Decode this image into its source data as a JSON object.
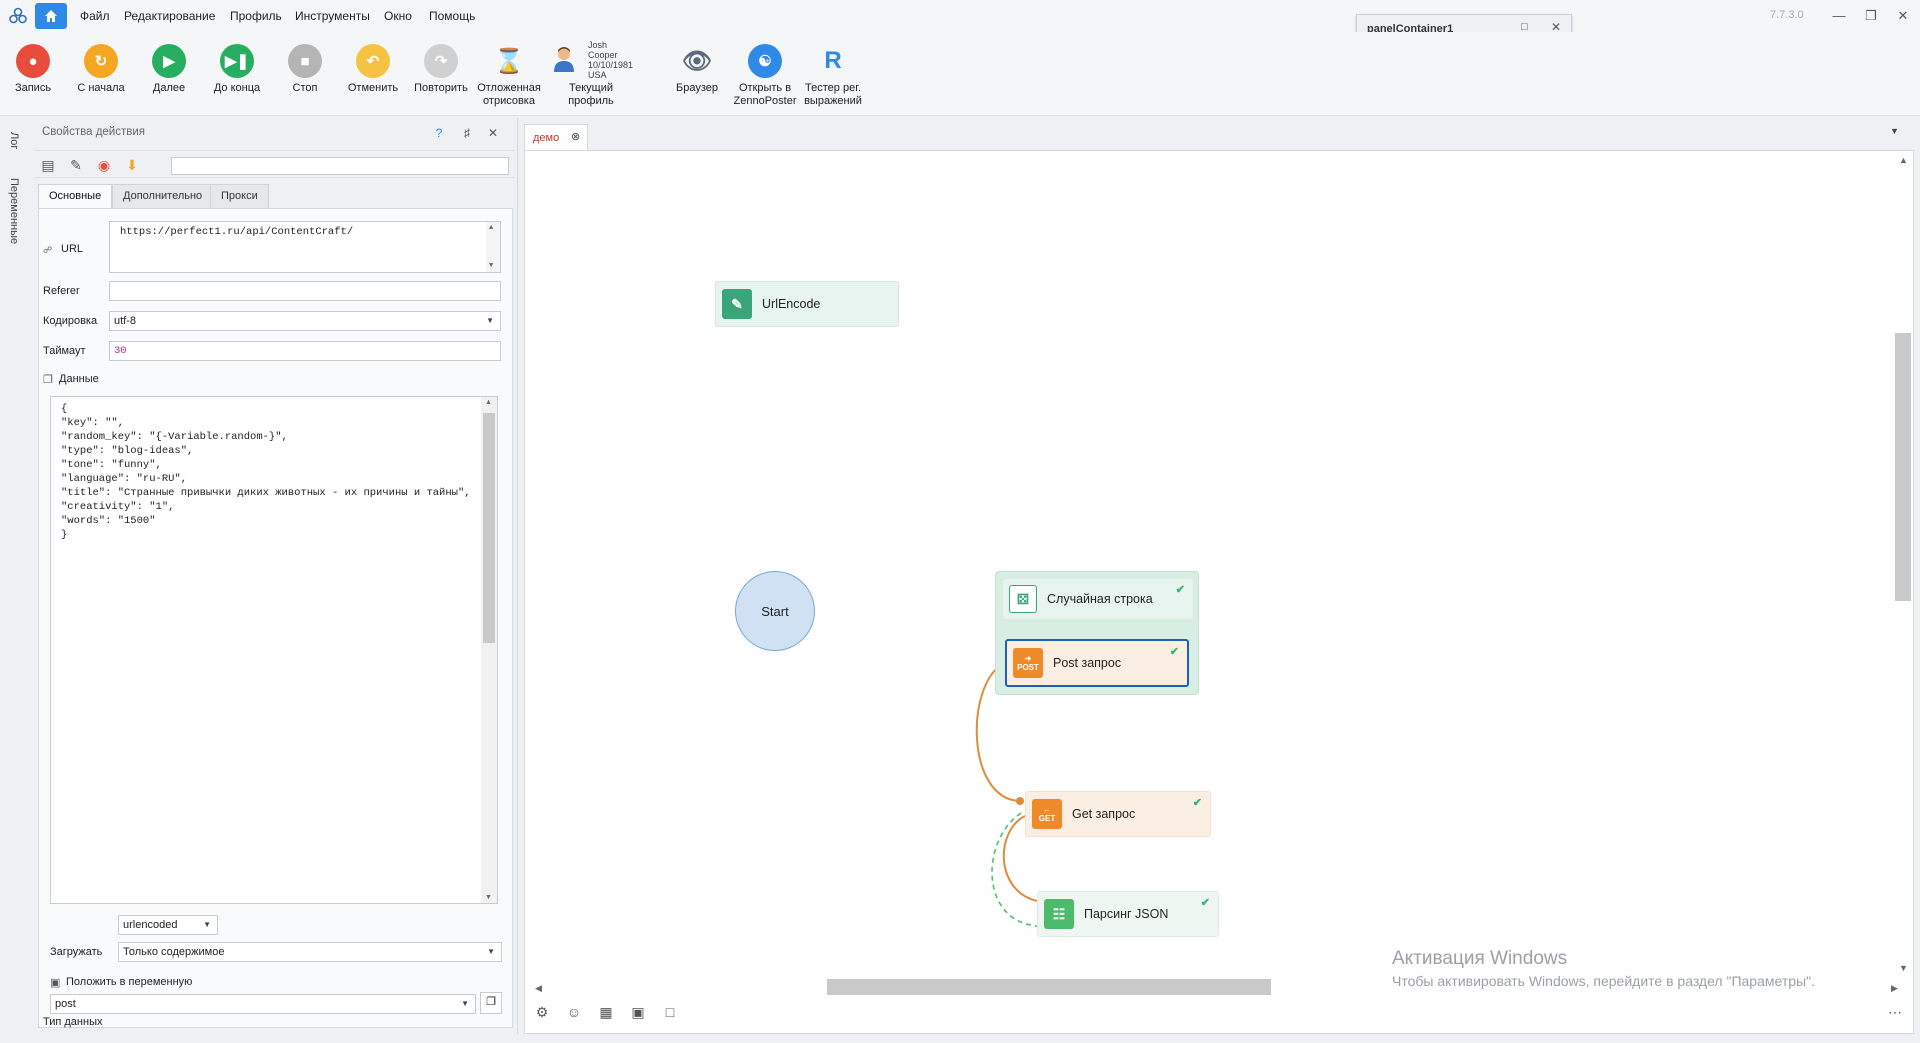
{
  "menu": {
    "items": [
      "Файл",
      "Редактирование",
      "Профиль",
      "Инструменты",
      "Окно",
      "Помощь"
    ],
    "version": "7.7.3.0"
  },
  "panel_container": {
    "title": "panelContainer1"
  },
  "toolbar": {
    "buttons": [
      {
        "label": "Запись",
        "icon": "record-icon",
        "color": "#e84c3d"
      },
      {
        "label": "С начала",
        "icon": "restart-icon",
        "color": "#f5a623"
      },
      {
        "label": "Далее",
        "icon": "play-icon",
        "color": "#27ae60"
      },
      {
        "label": "До конца",
        "icon": "play-to-end-icon",
        "color": "#27ae60"
      },
      {
        "label": "Стоп",
        "icon": "stop-icon",
        "color": "#b5b5b5"
      },
      {
        "label": "Отменить",
        "icon": "undo-icon",
        "color": "#f5c242"
      },
      {
        "label": "Повторить",
        "icon": "redo-icon",
        "color": "#d0d0d0"
      },
      {
        "label": "Отложенная\nотрисовка",
        "icon": "hourglass-icon",
        "color": "#8b5a2b"
      },
      {
        "label": "Текущий профиль",
        "icon": "profile-avatar-icon",
        "color": "#3a77c9"
      },
      {
        "label": "Браузер",
        "icon": "eye-icon",
        "color": "#5a6b7c"
      },
      {
        "label": "Открыть в\nZennoPoster",
        "icon": "zennoposter-icon",
        "color": "#2e8ae6"
      },
      {
        "label": "Тестер рег.\nвыражений",
        "icon": "regex-r-icon",
        "color": "#2e8ae6"
      }
    ],
    "profile": {
      "name": "Josh Cooper",
      "date": "10/10/1981",
      "country": "USA"
    }
  },
  "left_strip": {
    "tabs": [
      "Лог",
      "Переменные"
    ]
  },
  "props": {
    "title": "Свойства действия",
    "help": "?",
    "tabs": [
      "Основные",
      "Дополнительно",
      "Прокси"
    ],
    "url_label": "URL",
    "url_value": "https://perfect1.ru/api/ContentCraft/",
    "referer_label": "Referer",
    "referer_value": "",
    "encoding_label": "Кодировка",
    "encoding_value": "utf-8",
    "timeout_label": "Таймаут",
    "timeout_value": "30",
    "data_label": "Данные",
    "data_code": "{\n\"key\": \"\",\n\"random_key\": \"{-Variable.random-}\",\n\"type\": \"blog-ideas\",\n\"tone\": \"funny\",\n\"language\": \"ru-RU\",\n\"title\": \"Странные привычки диких животных - их причины и тайны\",\n\"creativity\": \"1\",\n\"words\": \"1500\"\n}",
    "datatype_label": "Тип данных",
    "datatype_value": "urlencoded",
    "load_label": "Загружать",
    "load_value": "Только содержимое",
    "store_label": "Положить в переменную",
    "store_value": "post"
  },
  "canvas": {
    "tab_title": "демо",
    "nodes": {
      "urlencode": "UrlEncode",
      "start": "Start",
      "random_string": "Случайная строка",
      "post": "Post запрос",
      "post_badge": "POST",
      "get": "Get запрос",
      "get_badge": "GET",
      "parse_json": "Парсинг JSON"
    }
  },
  "watermark": {
    "line1": "Активация Windows",
    "line2": "Чтобы активировать Windows, перейдите в раздел \"Параметры\"."
  },
  "colors": {
    "accent": "#2e8ae6",
    "node_green_bg": "#e8f4ef",
    "node_orange_bg": "#fbefe3",
    "group_bg": "#d8eee2",
    "link_orange": "#e08a3c",
    "link_green": "#4cc06a"
  }
}
